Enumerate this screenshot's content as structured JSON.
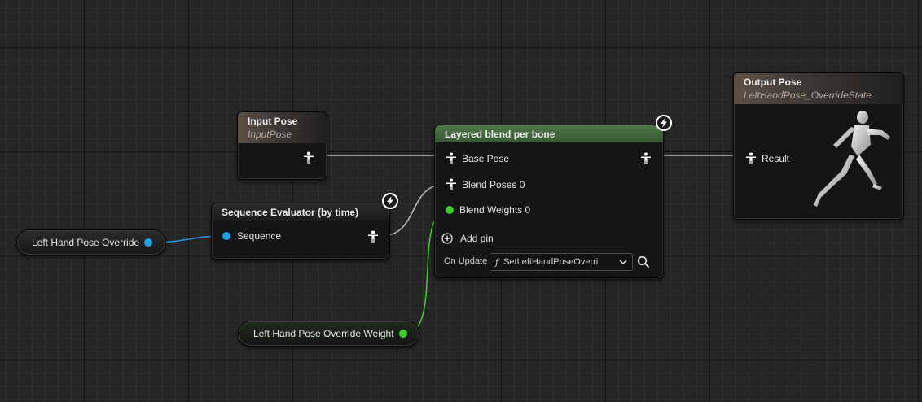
{
  "nodes": {
    "input_pose": {
      "title": "Input Pose",
      "subtitle": "InputPose"
    },
    "output_pose": {
      "title": "Output Pose",
      "subtitle": "LeftHandPose_OverrideState",
      "result_label": "Result"
    },
    "layered_blend": {
      "title": "Layered blend per bone",
      "base_pose": "Base Pose",
      "blend_poses": "Blend Poses 0",
      "blend_weights": "Blend Weights 0",
      "add_pin": "Add pin",
      "on_update_label": "On Update",
      "on_update_function": "SetLeftHandPoseOverri",
      "function_glyph": "ƒ"
    },
    "sequence_evaluator": {
      "title": "Sequence Evaluator (by time)",
      "sequence_label": "Sequence"
    },
    "left_hand_pose_override": {
      "label": "Left Hand Pose Override"
    },
    "left_hand_pose_override_weight": {
      "label": "Left Hand Pose Override Weight"
    }
  },
  "icons": [
    "pose-pin-icon",
    "lightning-icon",
    "add-pin-icon",
    "chevron-down-icon",
    "search-icon",
    "mannequin-preview-icon"
  ],
  "colors": {
    "pose_wire": "#b8b8b8",
    "object_pin": "#1ea0ea",
    "float_pin": "#3fd12b",
    "blend_header": "#4e7748"
  }
}
